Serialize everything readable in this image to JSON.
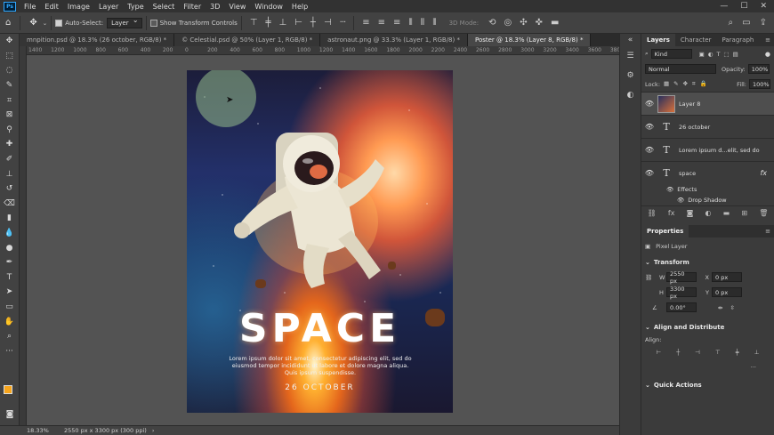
{
  "menubar": {
    "logo": "Ps",
    "items": [
      "File",
      "Edit",
      "Image",
      "Layer",
      "Type",
      "Select",
      "Filter",
      "3D",
      "View",
      "Window",
      "Help"
    ]
  },
  "options": {
    "auto_select_label": "Auto-Select:",
    "auto_select_value": "Layer",
    "show_transform_label": "Show Transform Controls",
    "mode_3d_label": "3D Mode:"
  },
  "tabs": [
    {
      "label": "mnpition.psd @ 18.3% (26 october, RGB/8) *",
      "active": false
    },
    {
      "label": "© Celestial.psd @ 50% (Layer 1, RGB/8) *",
      "active": false
    },
    {
      "label": "astronaut.png @ 33.3% (Layer 1, RGB/8) *",
      "active": false
    },
    {
      "label": "Poster @ 18.3% (Layer 8, RGB/8) *",
      "active": true
    }
  ],
  "ruler": [
    "1400",
    "1200",
    "1000",
    "800",
    "600",
    "400",
    "200",
    "0",
    "200",
    "400",
    "600",
    "800",
    "1000",
    "1200",
    "1400",
    "1600",
    "1800",
    "2000",
    "2200",
    "2400",
    "2600",
    "2800",
    "3000",
    "3200",
    "3400",
    "3600",
    "3800"
  ],
  "poster": {
    "title": "SPACE",
    "body": "Lorem ipsum dolor sit amet, consectetur adipiscing elit, sed do eiusmod tempor incididunt ut labore et dolore magna aliqua. Quis ipsum suspendisse.",
    "date": "26 OCTOBER"
  },
  "status": {
    "zoom": "18.33%",
    "doc_size": "2550 px x 3300 px (300 ppi)"
  },
  "layers_panel": {
    "tabs": [
      "Layers",
      "Character",
      "Paragraph"
    ],
    "filter": "Kind",
    "blend_mode": "Normal",
    "opacity_label": "Opacity:",
    "opacity": "100%",
    "lock_label": "Lock:",
    "fill_label": "Fill:",
    "fill": "100%",
    "layers": [
      {
        "name": "Layer 8",
        "kind": "pixel",
        "selected": true
      },
      {
        "name": "26 october",
        "kind": "text",
        "selected": false
      },
      {
        "name": "Lorem ipsum d...elit, sed do",
        "kind": "text",
        "selected": false
      },
      {
        "name": "space",
        "kind": "text",
        "selected": false,
        "fx": "fx"
      }
    ],
    "effects_label": "Effects",
    "drop_shadow_label": "Drop Shadow"
  },
  "properties": {
    "tab": "Properties",
    "kind_label": "Pixel Layer",
    "transform_label": "Transform",
    "w_label": "W",
    "w": "2550 px",
    "h_label": "H",
    "h": "3300 px",
    "x_label": "X",
    "x": "0 px",
    "y_label": "Y",
    "y": "0 px",
    "angle": "0.00°",
    "align_label": "Align and Distribute",
    "align_sub": "Align:",
    "quick_actions_label": "Quick Actions"
  }
}
